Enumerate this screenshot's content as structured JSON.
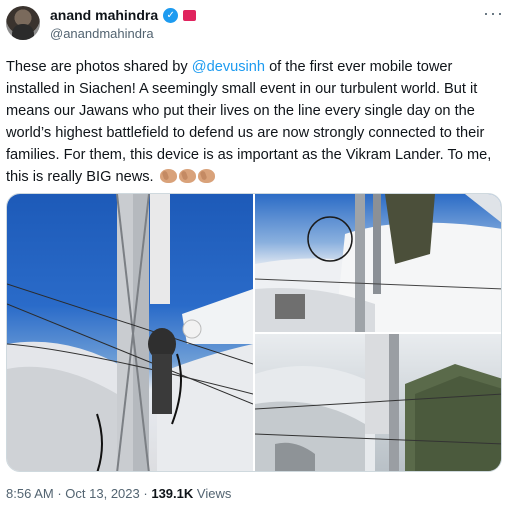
{
  "author": {
    "display_name": "anand mahindra",
    "handle": "@anandmahindra"
  },
  "tweet": {
    "text_before_mention": "These are photos shared by ",
    "mention": "@devusinh",
    "text_after_mention": " of the first ever mobile tower installed in Siachen! A seemingly small event in our turbulent world. But it means our  Jawans who put their lives on the line every single day on the world’s highest battlefield to defend us are now strongly connected to their families. For them, this device is as important as the Vikram Lander. To me, this is really BIG news."
  },
  "meta": {
    "time": "8:56 AM",
    "separator": "·",
    "date": "Oct 13, 2023",
    "views_count": "139.1K",
    "views_label": "Views"
  },
  "icons": {
    "verified": "verified-badge-icon",
    "more": "more-options-icon",
    "clap": "clapping-hands-icon"
  },
  "colors": {
    "accent": "#1d9bf0",
    "text_primary": "#0f1419",
    "text_secondary": "#536471",
    "org_badge": "#e0245e"
  }
}
